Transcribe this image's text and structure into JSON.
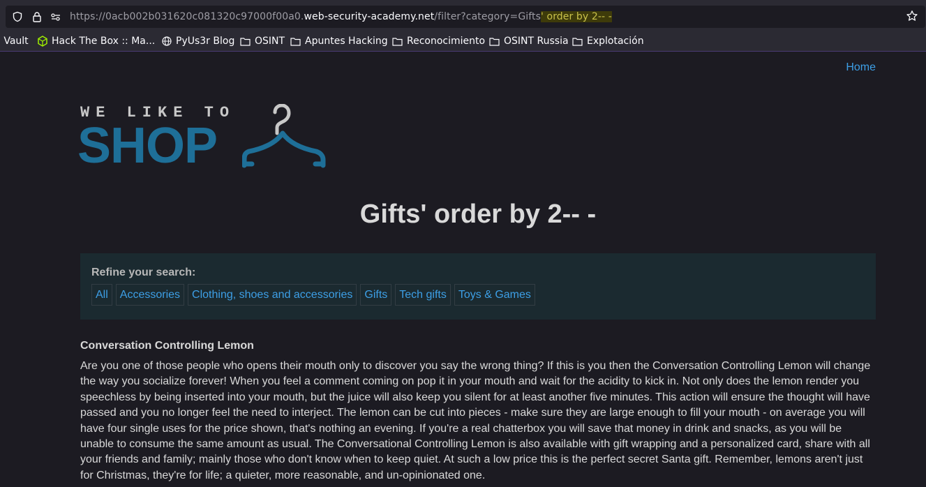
{
  "browser": {
    "url": {
      "scheme_prefix": "https://0acb002b031620c081320c97000f00a0.",
      "domain": "web-security-academy.net",
      "path": "/filter?category=Gifts",
      "highlight": "' order by 2-- -"
    },
    "bookmarks": [
      {
        "label": "g Vault",
        "icon": "none"
      },
      {
        "label": "Hack The Box :: Ma...",
        "icon": "htb-cube-icon"
      },
      {
        "label": "PyUs3r Blog",
        "icon": "globe-icon"
      },
      {
        "label": "OSINT",
        "icon": "folder-icon"
      },
      {
        "label": "Apuntes Hacking",
        "icon": "folder-icon"
      },
      {
        "label": "Reconocimiento",
        "icon": "folder-icon"
      },
      {
        "label": "OSINT Russia",
        "icon": "folder-icon"
      },
      {
        "label": "Explotación",
        "icon": "folder-icon"
      }
    ]
  },
  "header": {
    "home_link": "Home"
  },
  "logo": {
    "top_text": "WE LIKE TO",
    "main_text": "SHOP"
  },
  "page": {
    "title": "Gifts' order by 2-- -"
  },
  "filters": {
    "label": "Refine your search:",
    "items": [
      "All",
      "Accessories",
      "Clothing, shoes and accessories",
      "Gifts",
      "Tech gifts",
      "Toys & Games"
    ]
  },
  "product": {
    "name": "Conversation Controlling Lemon",
    "description": "Are you one of those people who opens their mouth only to discover you say the wrong thing? If this is you then the Conversation Controlling Lemon will change the way you socialize forever! When you feel a comment coming on pop it in your mouth and wait for the acidity to kick in. Not only does the lemon render you speechless by being inserted into your mouth, but the juice will also keep you silent for at least another five minutes. This action will ensure the thought will have passed and you no longer feel the need to interject. The lemon can be cut into pieces - make sure they are large enough to fill your mouth - on average you will have four single uses for the price shown, that's nothing an evening. If you're a real chatterbox you will save that money in drink and snacks, as you will be unable to consume the same amount as usual. The Conversational Controlling Lemon is also available with gift wrapping and a personalized card, share with all your friends and family; mainly those who don't know when to keep quiet. At such a low price this is the perfect secret Santa gift. Remember, lemons aren't just for Christmas, they're for life; a quieter, more reasonable, and un-opinionated one."
  },
  "colors": {
    "background": "#1c1b22",
    "link": "#3d9fe6",
    "logo_blue": "#1e6f98",
    "filter_box": "#1b2a30",
    "url_highlight": "#3e3b0a"
  }
}
